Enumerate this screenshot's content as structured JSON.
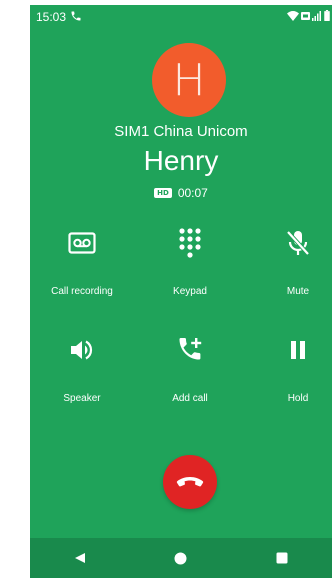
{
  "status_bar": {
    "time": "15:03",
    "icons": [
      "phone-call-icon",
      "wifi-icon",
      "sim-icon",
      "signal-icon",
      "battery-icon"
    ]
  },
  "call": {
    "avatar_letter": "H",
    "sim_label": "SIM1 China Unicom",
    "caller_name": "Henry",
    "hd_badge": "HD",
    "duration": "00:07"
  },
  "actions": [
    {
      "label": "Call recording",
      "icon": "call-recording-icon"
    },
    {
      "label": "Keypad",
      "icon": "keypad-icon"
    },
    {
      "label": "Mute",
      "icon": "mute-icon"
    },
    {
      "label": "Speaker",
      "icon": "speaker-icon"
    },
    {
      "label": "Add call",
      "icon": "add-call-icon"
    },
    {
      "label": "Hold",
      "icon": "hold-icon"
    }
  ],
  "end_call": {
    "icon": "end-call-icon"
  },
  "navigation": {
    "buttons": [
      "back-icon",
      "home-icon",
      "recents-icon"
    ]
  },
  "colors": {
    "background": "#1fa35a",
    "avatar": "#f25c2c",
    "end_call": "#e02424",
    "nav_bar": "#198a4c"
  }
}
